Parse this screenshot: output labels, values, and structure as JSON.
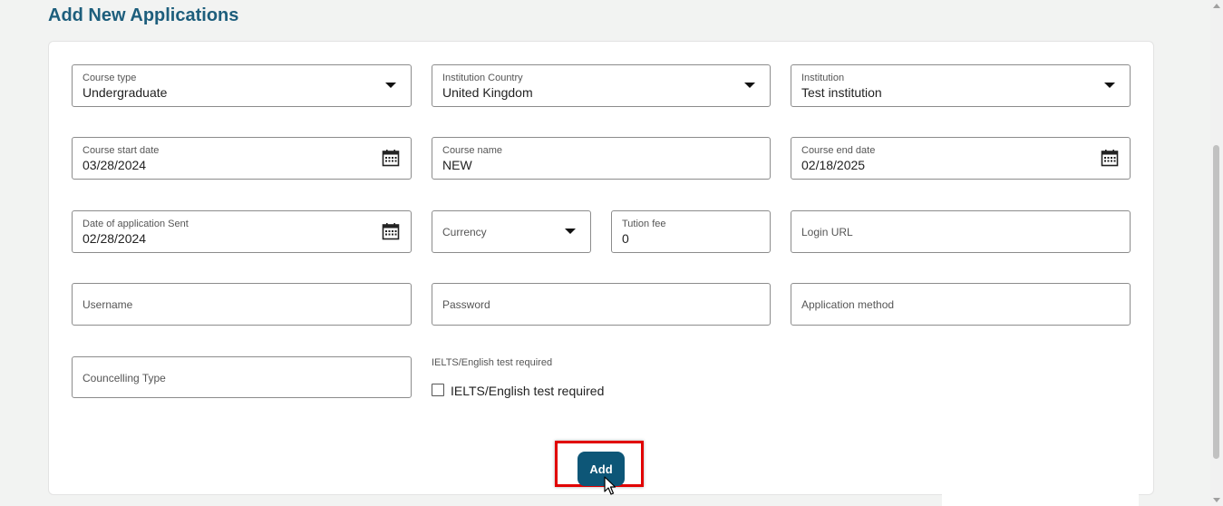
{
  "page": {
    "title": "Add New Applications"
  },
  "fields": {
    "course_type": {
      "label": "Course type",
      "value": "Undergraduate"
    },
    "institution_country": {
      "label": "Institution Country",
      "value": "United Kingdom"
    },
    "institution": {
      "label": "Institution",
      "value": "Test institution"
    },
    "course_start_date": {
      "label": "Course start date",
      "value": "03/28/2024"
    },
    "course_name": {
      "label": "Course name",
      "value": "NEW"
    },
    "course_end_date": {
      "label": "Course end date",
      "value": "02/18/2025"
    },
    "date_application_sent": {
      "label": "Date of application Sent",
      "value": "02/28/2024"
    },
    "currency": {
      "placeholder": "Currency"
    },
    "tution_fee": {
      "label": "Tution fee",
      "value": "0"
    },
    "login_url": {
      "placeholder": "Login URL"
    },
    "username": {
      "placeholder": "Username"
    },
    "password": {
      "placeholder": "Password"
    },
    "application_method": {
      "placeholder": "Application method"
    },
    "councelling_type": {
      "placeholder": "Councelling Type"
    }
  },
  "ielts": {
    "group_label": "IELTS/English test required",
    "checkbox_label": "IELTS/English test required",
    "checked": false
  },
  "actions": {
    "add_label": "Add"
  },
  "colors": {
    "title": "#1d5e7c",
    "primary_button": "#0d5677",
    "highlight": "#e10000"
  }
}
